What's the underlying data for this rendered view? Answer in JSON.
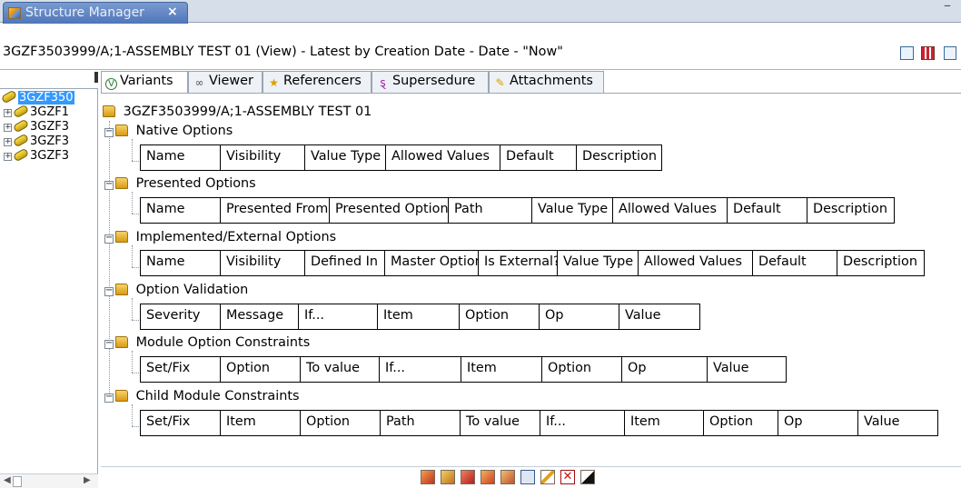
{
  "window": {
    "tab_title": "Structure Manager",
    "tab_close": "×",
    "minimize": "–"
  },
  "title_bar": {
    "text": "3GZF3503999/A;1-ASSEMBLY TEST 01 (View) - Latest by Creation Date - Date - \"Now\""
  },
  "tree": {
    "root": "3GZF350",
    "children": [
      "3GZF1",
      "3GZF3",
      "3GZF3",
      "3GZF3"
    ]
  },
  "tabs": [
    {
      "label": "Variants",
      "icon": "variants-icon",
      "active": true
    },
    {
      "label": "Viewer",
      "icon": "glasses-icon",
      "active": false
    },
    {
      "label": "Referencers",
      "icon": "referencers-icon",
      "active": false
    },
    {
      "label": "Supersedure",
      "icon": "supersedure-icon",
      "active": false
    },
    {
      "label": "Attachments",
      "icon": "attachments-icon",
      "active": false
    }
  ],
  "content": {
    "root_label": "3GZF3503999/A;1-ASSEMBLY TEST 01",
    "sections": [
      {
        "name": "Native Options",
        "columns": [
          "Name",
          "Visibility",
          "Value Type",
          "Allowed Values",
          "Default",
          "Description"
        ]
      },
      {
        "name": "Presented Options",
        "columns": [
          "Name",
          "Presented From",
          "Presented Option",
          "Path",
          "Value Type",
          "Allowed Values",
          "Default",
          "Description"
        ]
      },
      {
        "name": "Implemented/External Options",
        "columns": [
          "Name",
          "Visibility",
          "Defined In",
          "Master Option",
          "Is External?",
          "Value Type",
          "Allowed Values",
          "Default",
          "Description"
        ]
      },
      {
        "name": "Option Validation",
        "columns": [
          "Severity",
          "Message",
          "If...",
          "Item",
          "Option",
          "Op",
          "Value"
        ]
      },
      {
        "name": "Module Option Constraints",
        "columns": [
          "Set/Fix",
          "Option",
          "To value",
          "If...",
          "Item",
          "Option",
          "Op",
          "Value"
        ]
      },
      {
        "name": "Child Module Constraints",
        "columns": [
          "Set/Fix",
          "Item",
          "Option",
          "Path",
          "To value",
          "If...",
          "Item",
          "Option",
          "Op",
          "Value"
        ]
      }
    ]
  },
  "bottom_toolbar": {
    "buttons": [
      "add-option-icon",
      "add-presented-icon",
      "add-implemented-icon",
      "add-validation-icon",
      "add-constraint-icon",
      "copy-icon",
      "edit-icon",
      "delete-icon",
      "toggle-icon"
    ]
  },
  "colors": {
    "selection": "#3399ff",
    "tab_active": "#4f76b8",
    "folder": "#d99a12"
  }
}
